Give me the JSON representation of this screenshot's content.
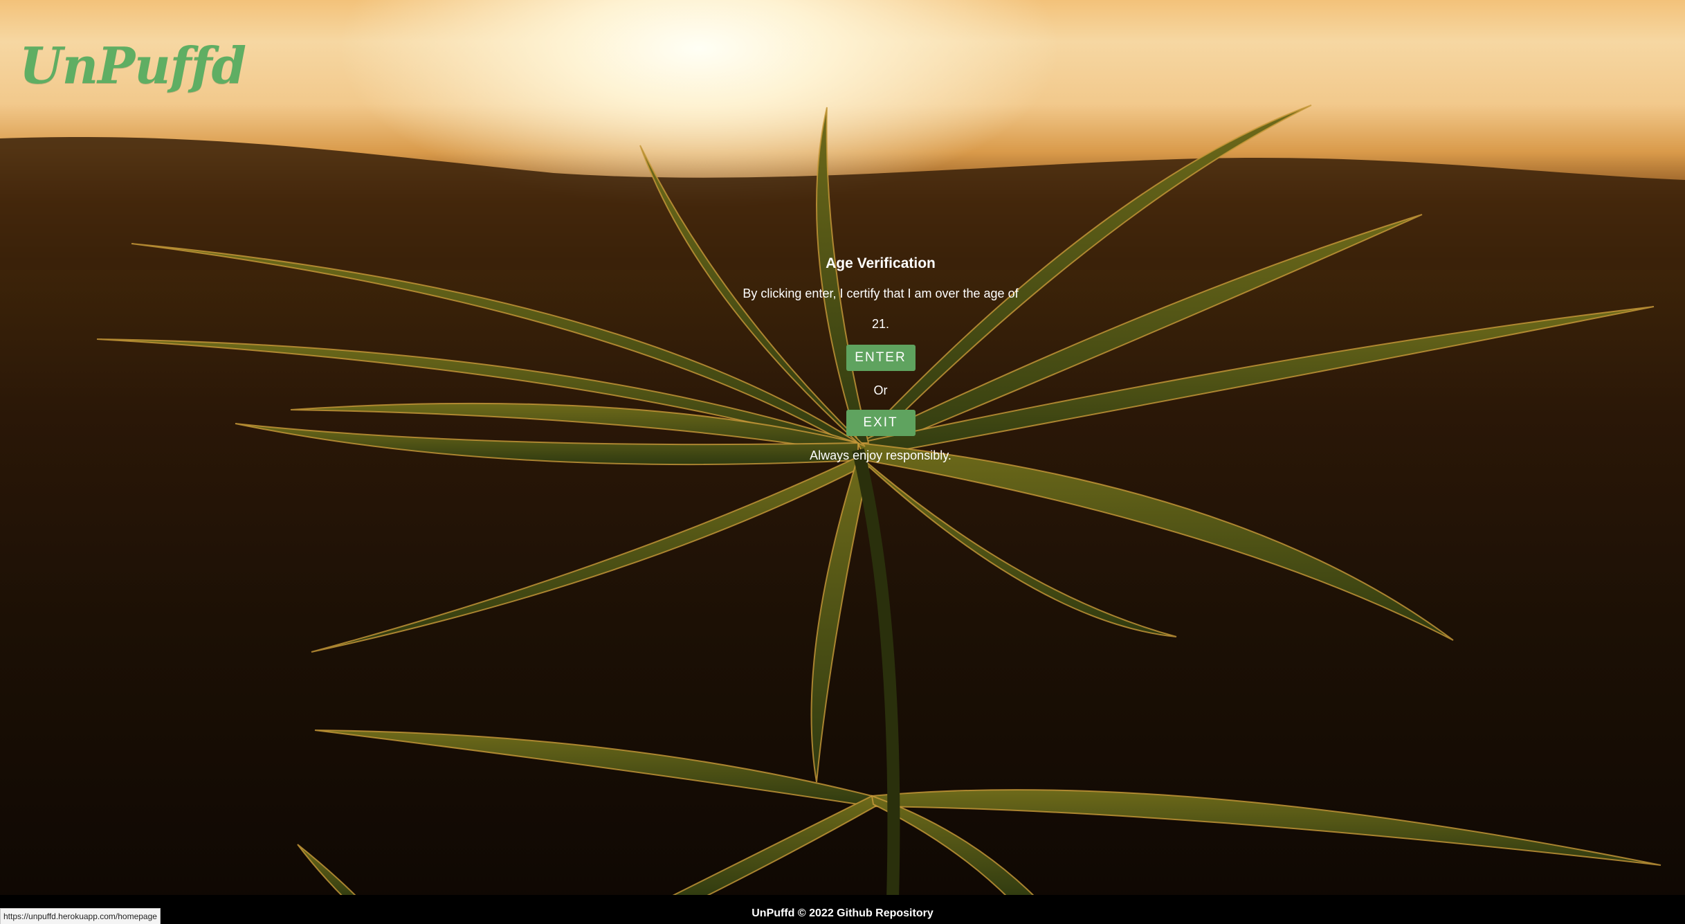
{
  "brand": {
    "logo_text": "UnPuffd",
    "logo_color": "#5fae63"
  },
  "modal": {
    "title": "Age Verification",
    "certify_text": "By clicking enter, I certify that I am over the age of 21.",
    "enter_label": "ENTER",
    "or_text": "Or",
    "exit_label": "EXIT",
    "footnote": "Always enjoy responsibly.",
    "button_color": "#5fa35f"
  },
  "footer": {
    "text": "UnPuffd © 2022 Github Repository"
  },
  "status_bar": {
    "url": "https://unpuffd.herokuapp.com/homepage"
  }
}
